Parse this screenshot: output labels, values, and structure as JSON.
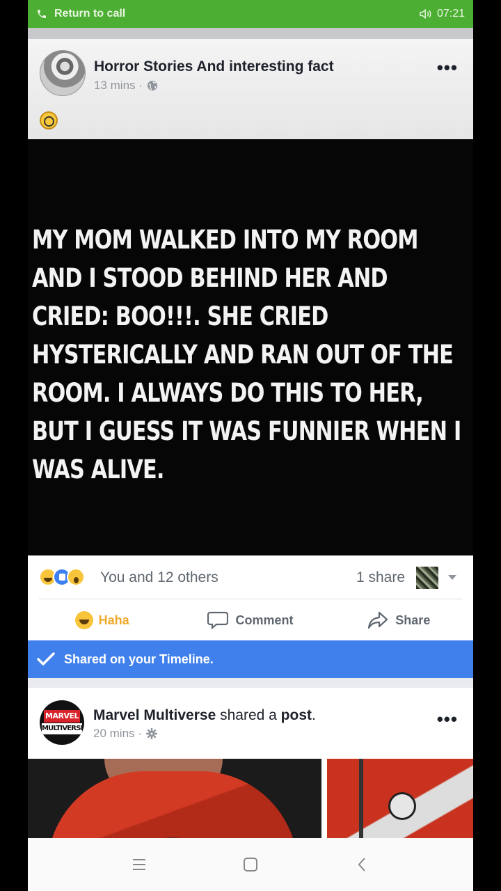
{
  "status_bar": {
    "call_label": "Return to call",
    "time": "07:21"
  },
  "post1": {
    "page_name": "Horror Stories And interesting fact",
    "time": "13 mins",
    "image_text": "My mom walked into my room and I stood behind her and cried: BOO!!!. She cried hysterically and ran out of the room. I always do this to her, but I guess it was funnier when I was alive.",
    "reactions_text": "You and 12 others",
    "shares_text": "1 share",
    "actions": {
      "haha": "Haha",
      "comment": "Comment",
      "share": "Share"
    }
  },
  "shared_banner": "Shared on your Timeline.",
  "post2": {
    "page_name": "Marvel Multiverse",
    "action_text": "shared a",
    "object_text": "post",
    "punct": ".",
    "time": "20 mins",
    "logo_top": "MARVEL",
    "logo_bottom": "MULTIVERSE"
  },
  "colors": {
    "call_green": "#4caf34",
    "shared_blue": "#4080ec",
    "haha_orange": "#f0a92a"
  }
}
